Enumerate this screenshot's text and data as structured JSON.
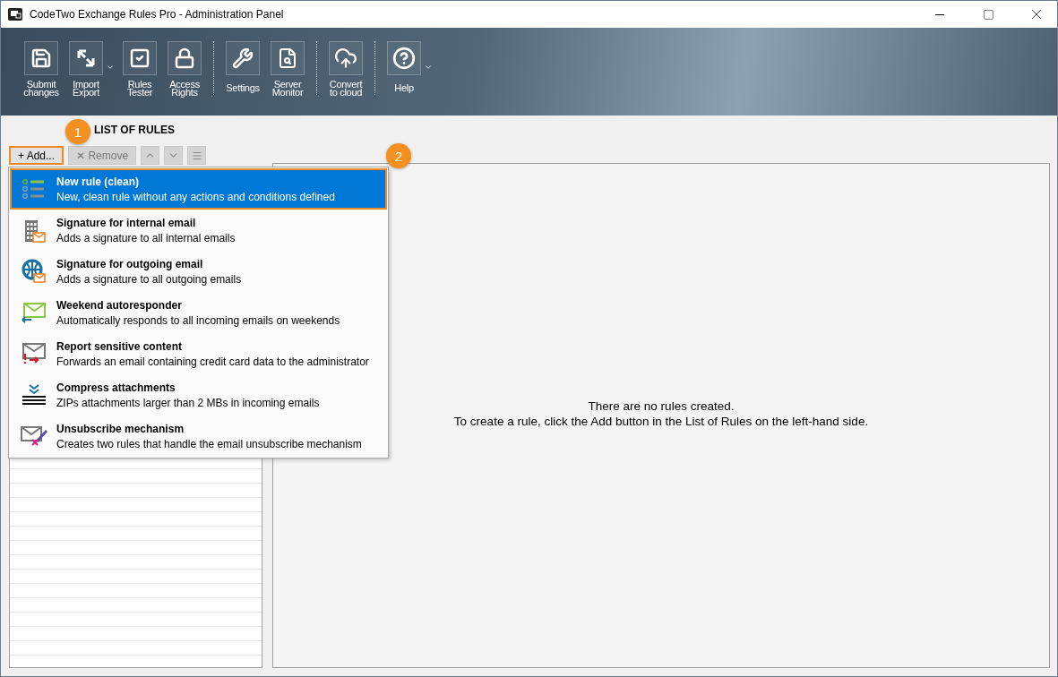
{
  "window": {
    "title": "CodeTwo Exchange Rules Pro  - Administration Panel"
  },
  "toolbar": {
    "groups": [
      {
        "buttons": [
          {
            "label": "Submit\nchanges",
            "dropdown": false
          },
          {
            "label": "Import\nExport",
            "dropdown": true
          },
          {
            "label": "Rules\nTester",
            "dropdown": false
          },
          {
            "label": "Access\nRights",
            "dropdown": false
          }
        ]
      },
      {
        "buttons": [
          {
            "label": "Settings",
            "dropdown": false
          },
          {
            "label": "Server\nMonitor",
            "dropdown": false
          }
        ]
      },
      {
        "buttons": [
          {
            "label": "Convert\nto cloud",
            "dropdown": false
          }
        ]
      },
      {
        "buttons": [
          {
            "label": "Help",
            "dropdown": true
          }
        ]
      }
    ]
  },
  "list_of_rules": {
    "heading": "LIST OF RULES",
    "buttons": [
      {
        "label": "+ Add...",
        "kind": "text",
        "disabled": false,
        "highlighted": true
      },
      {
        "label": "✕ Remove",
        "kind": "text",
        "disabled": true,
        "highlighted": false
      },
      {
        "kind": "up",
        "disabled": true,
        "highlighted": false
      },
      {
        "kind": "down",
        "disabled": true,
        "highlighted": false
      },
      {
        "kind": "menu",
        "disabled": true,
        "highlighted": false
      }
    ]
  },
  "add_menu": {
    "items": [
      {
        "title": "New rule (clean)",
        "description": "New, clean rule without any actions and conditions defined",
        "selected": true
      },
      {
        "title": "Signature for internal email",
        "description": "Adds a signature to all internal emails",
        "selected": false
      },
      {
        "title": "Signature for outgoing email",
        "description": "Adds a signature to all outgoing emails",
        "selected": false
      },
      {
        "title": "Weekend autoresponder",
        "description": "Automatically responds to all incoming emails on weekends",
        "selected": false
      },
      {
        "title": "Report sensitive content",
        "description": "Forwards an email containing credit card data to the administrator",
        "selected": false
      },
      {
        "title": "Compress attachments",
        "description": "ZIPs attachments larger than 2 MBs in incoming emails",
        "selected": false
      },
      {
        "title": "Unsubscribe mechanism",
        "description": "Creates two rules that handle the email unsubscribe mechanism",
        "selected": false
      }
    ]
  },
  "rule_details": {
    "empty_message": [
      "There are no rules created.",
      "To create a rule, click the Add button in the List of Rules on the left-hand side."
    ]
  },
  "callouts": [
    "1",
    "2"
  ]
}
